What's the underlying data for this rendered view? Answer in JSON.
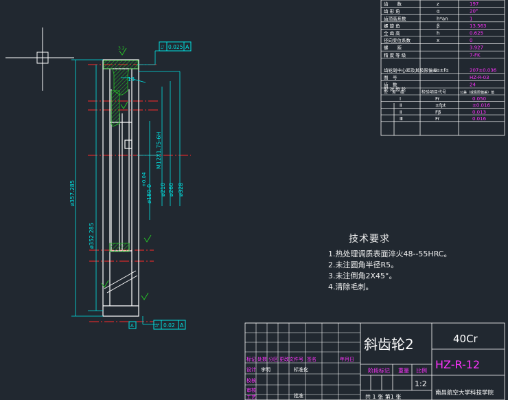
{
  "colors": {
    "background": "#212830",
    "outline": "#ffffff",
    "dimension": "#00e5e5",
    "centerline": "#ff2a2a",
    "hatch": "#27c427",
    "magenta": "#ff33ff",
    "yellow": "#ffff00"
  },
  "drawing": {
    "tolerance_top_symbol": "⌰",
    "tolerance_top_value": "0.025",
    "tolerance_top_datum": "A",
    "tolerance_bottom_symbol": "⌰",
    "tolerance_bottom_value": "0.02",
    "tolerance_bottom_datum": "A",
    "roughness_top": "3.2",
    "dim_13": "13",
    "dim_thread": "M12X1.75-6H",
    "dim_004": "+0.04",
    "dim_180": "ø180-0",
    "dim_210": "ø210",
    "dim_260": "ø260",
    "dim_328": "ø328",
    "dim_357": "ø357.285",
    "dim_352": "ø352.285",
    "datum_label": "A"
  },
  "params": [
    {
      "name": "齿　　数",
      "sym": "z",
      "val": "197"
    },
    {
      "name": "齿 形 角",
      "sym": "α",
      "val": "20°"
    },
    {
      "name": "齿顶高系数",
      "sym": "h*an",
      "val": "1"
    },
    {
      "name": "螺 旋 角",
      "sym": "β",
      "val": "13.563"
    },
    {
      "name": "全 齿 高",
      "sym": "h",
      "val": "0.625"
    },
    {
      "name": "径向变位系数",
      "sym": "x",
      "val": "0"
    },
    {
      "name": "螺　　距",
      "sym": "",
      "val": "3.927"
    },
    {
      "name": "精 度 等 级",
      "sym": "",
      "val": "7-FK"
    },
    {
      "name": "齿轮副中心距及其极限偏差",
      "sym": "α±fα",
      "val": "207±0.036"
    },
    {
      "name": "图　号",
      "sym": "",
      "val": "HZ-R-03"
    },
    {
      "name": "齿　数",
      "sym": "",
      "val": "24"
    }
  ],
  "params_pair_label": "配 对 齿 轮",
  "params_tol_header": {
    "a": "公　差　组",
    "b": "检验项目代号",
    "c": "公差（或极限偏差）值"
  },
  "params_tol_rows": [
    {
      "grp": "Ⅰ",
      "sym": "Fr",
      "val": "0.050"
    },
    {
      "grp": "Ⅱ",
      "sym": "±fpt",
      "val": "±0.016"
    },
    {
      "grp": "Ⅱ",
      "sym": "Fβ",
      "val": "0.013"
    },
    {
      "grp": "Ⅲ",
      "sym": "Fr",
      "val": "0.016"
    }
  ],
  "tech_req": {
    "title": "技术要求",
    "items": [
      "1.热处理调质表面淬火48--55HRC。",
      "2.未注圆角半径R5。",
      "3.未注倒角2X45°。",
      "4.清除毛刺。"
    ]
  },
  "title_block": {
    "part_name": "斜齿轮2",
    "material": "40Cr",
    "drawing_no": "HZ-R-12",
    "school": "南昌航空大学科技学院",
    "scale": "1:2",
    "row_labels": [
      "标记",
      "处数",
      "分区",
      "更改文件号",
      "签名",
      "年月日"
    ],
    "left_labels": [
      "设计",
      "校核",
      "审核",
      "工艺"
    ],
    "designer": "李明",
    "std_label": "标准化",
    "approve_label": "批准",
    "stage_label": "阶段标记",
    "weight_label": "重量",
    "scale_label": "比例",
    "sheet_text": "共 1 张 第1 张"
  }
}
